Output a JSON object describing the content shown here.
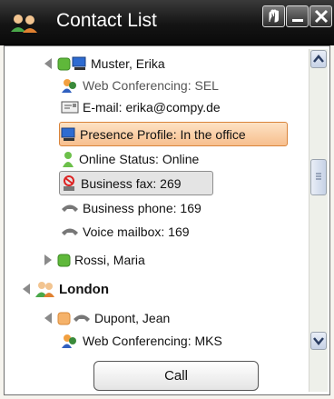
{
  "window": {
    "title": "Contact List",
    "controls": [
      "pin-icon",
      "minimize-icon",
      "close-icon"
    ]
  },
  "rows": [
    {
      "text": "Muster, Erika",
      "icons": [
        "collapse-arrow-icon",
        "presence-green-icon",
        "computer-icon"
      ]
    },
    {
      "text": "Web Conferencing: SEL",
      "icons": [
        "web-conferencing-icon"
      ],
      "dim": true
    },
    {
      "text": "E-mail: erika@compy.de",
      "icons": [
        "email-icon"
      ]
    },
    {
      "text": "Presence Profile: In the office",
      "icons": [
        "computer-icon"
      ],
      "highlight": "orange"
    },
    {
      "text": "Online Status: Online",
      "icons": [
        "person-online-icon"
      ]
    },
    {
      "text": "Business fax: 269",
      "icons": [
        "fax-blocked-icon"
      ],
      "highlight": "gray"
    },
    {
      "text": "Business phone: 169",
      "icons": [
        "phone-icon"
      ]
    },
    {
      "text": "Voice mailbox: 169",
      "icons": [
        "phone-icon"
      ]
    },
    {
      "text": "Rossi, Maria",
      "icons": [
        "expand-arrow-icon",
        "presence-green-icon"
      ]
    },
    {
      "text": "London",
      "icons": [
        "collapse-arrow-icon",
        "group-icon"
      ],
      "bold": true
    },
    {
      "text": "Dupont, Jean",
      "icons": [
        "collapse-arrow-icon",
        "presence-orange-icon",
        "phone-icon"
      ]
    },
    {
      "text": "Web Conferencing: MKS",
      "icons": [
        "web-conferencing-icon"
      ]
    }
  ],
  "call_button": "Call",
  "colors": {
    "title_bar": "#1c1c1c",
    "presence_green": "#5fb83a",
    "presence_orange": "#f5b26a",
    "highlight_orange": "#f7bf8e",
    "highlight_gray": "#e4e4e4"
  }
}
